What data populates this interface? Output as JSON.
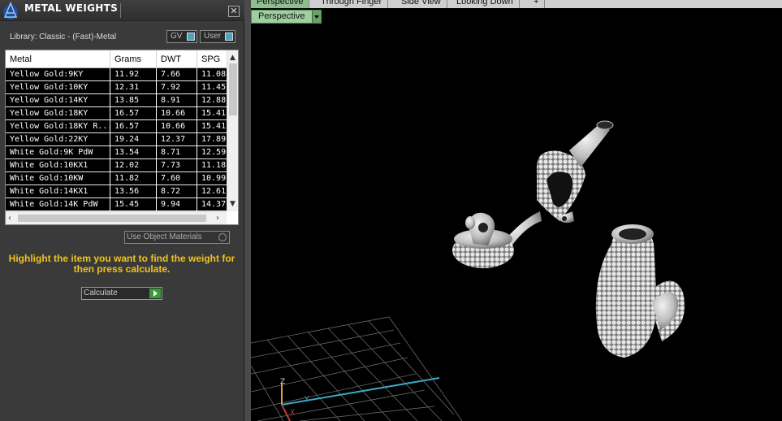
{
  "panel": {
    "title": "METAL WEIGHTS",
    "close_glyph": "✕",
    "library_label": "Library: Classic - (Fast)-Metal",
    "gv_label": "GV",
    "user_label": "User"
  },
  "table": {
    "headers": [
      "Metal",
      "Grams",
      "DWT",
      "SPG"
    ],
    "rows": [
      [
        "Yellow Gold:9KY",
        "11.92",
        "7.66",
        "11.08"
      ],
      [
        "Yellow Gold:10KY",
        "12.31",
        "7.92",
        "11.45"
      ],
      [
        "Yellow Gold:14KY",
        "13.85",
        "8.91",
        "12.88"
      ],
      [
        "Yellow Gold:18KY",
        "16.57",
        "10.66",
        "15.41"
      ],
      [
        "Yellow Gold:18KY R...",
        "16.57",
        "10.66",
        "15.41"
      ],
      [
        "Yellow Gold:22KY",
        "19.24",
        "12.37",
        "17.89"
      ],
      [
        "White Gold:9K PdW",
        "13.54",
        "8.71",
        "12.59"
      ],
      [
        "White Gold:10KX1",
        "12.02",
        "7.73",
        "11.18"
      ],
      [
        "White Gold:10KW",
        "11.82",
        "7.60",
        "10.99"
      ],
      [
        "White Gold:14KX1",
        "13.56",
        "8.72",
        "12.61"
      ],
      [
        "White Gold:14K PdW",
        "15.45",
        "9.94",
        "14.37"
      ]
    ]
  },
  "use_object_materials_label": "Use Object Materials",
  "instruction": "Highlight the item you want to find the weight for then press calculate.",
  "calculate_label": "Calculate",
  "viewport": {
    "tabs": [
      "Perspective",
      "Through Finger",
      "Side View",
      "Looking Down",
      "+"
    ],
    "view_dropdown": "Perspective",
    "axis_labels": [
      "Z",
      "Y",
      "X"
    ]
  },
  "colors": {
    "instruction": "#f2c31a",
    "active_tab": "#8fbf8f",
    "toggle_knob": "#4aa6b8"
  }
}
